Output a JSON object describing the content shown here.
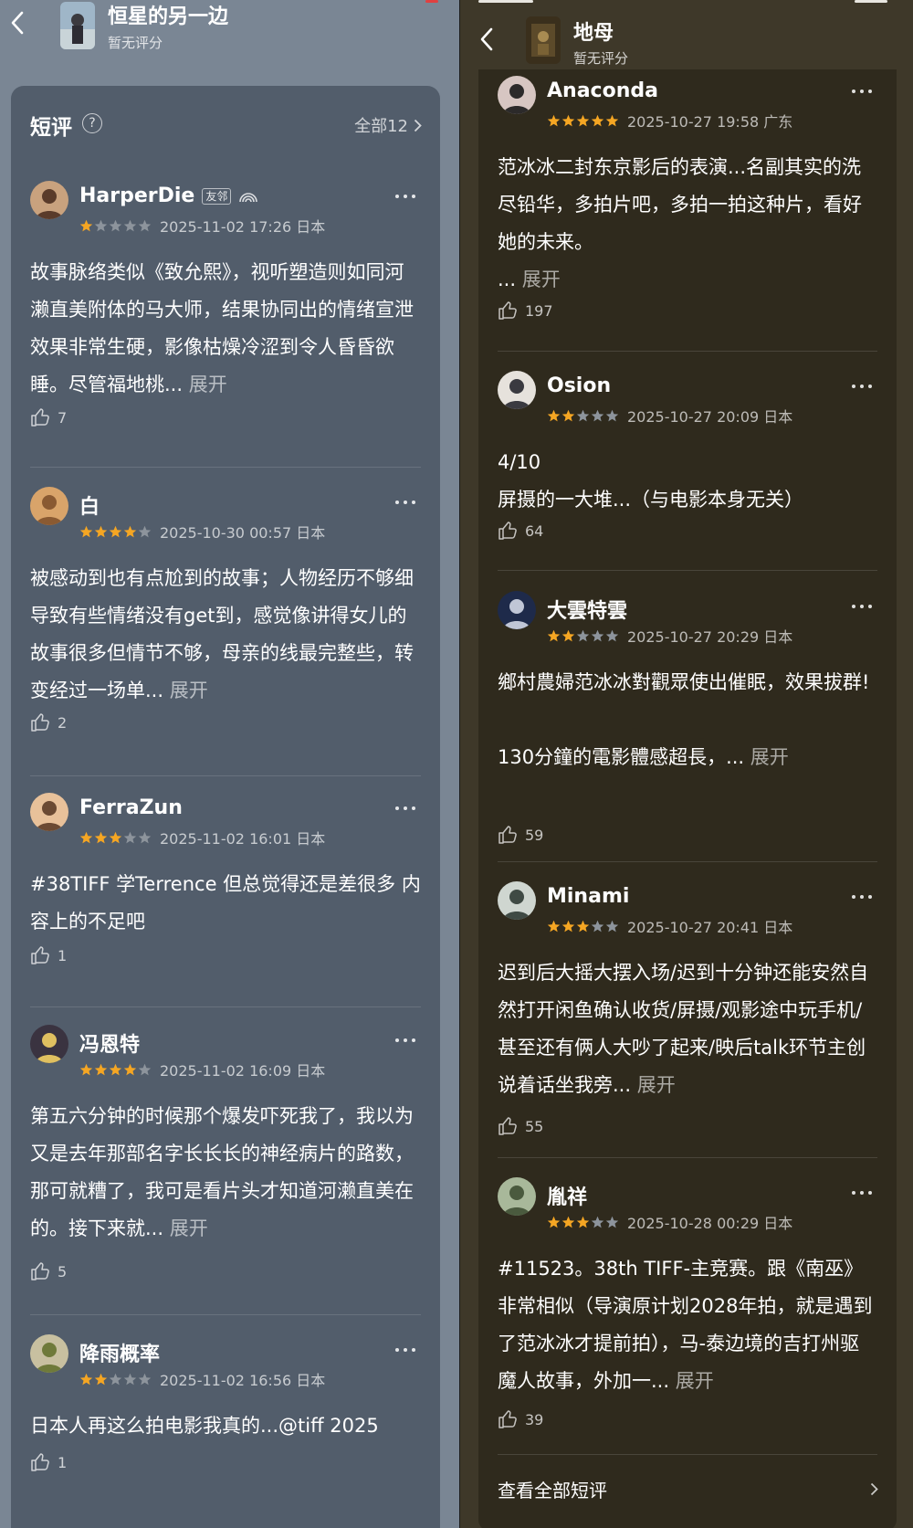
{
  "left": {
    "header": {
      "title": "恒星的另一边",
      "rating": "暂无评分"
    },
    "section": {
      "title": "短评",
      "all_link": "全部12"
    },
    "reviews": [
      {
        "user": "HarperDie",
        "badge": "友邻",
        "stars": 1,
        "meta": "2025-11-02 17:26 日本",
        "body": "故事脉络类似《致允熙》，视听塑造则如同河濑直美附体的马大师，结果协同出的情绪宣泄效果非常生硬，影像枯燥冷涩到令人昏昏欲睡。尽管福地桃...",
        "expand": "展开",
        "likes": "7"
      },
      {
        "user": "白",
        "stars": 4,
        "meta": "2025-10-30 00:57 日本",
        "body": "被感动到也有点尬到的故事；人物经历不够细导致有些情绪没有get到，感觉像讲得女儿的故事很多但情节不够，母亲的线最完整些，转变经过一场单...",
        "expand": "展开",
        "likes": "2"
      },
      {
        "user": "FerraZun",
        "stars": 3,
        "meta": "2025-11-02 16:01 日本",
        "body": "#38TIFF 学Terrence 但总觉得还是差很多 内容上的不足吧",
        "expand": "",
        "likes": "1"
      },
      {
        "user": "冯恩特",
        "stars": 4,
        "meta": "2025-11-02 16:09 日本",
        "body": "第五六分钟的时候那个爆发吓死我了，我以为又是去年那部名字长长长的神经病片的路数，那可就糟了，我可是看片头才知道河濑直美在的。接下来就...",
        "expand": "展开",
        "likes": "5"
      },
      {
        "user": "降雨概率",
        "stars": 2,
        "meta": "2025-11-02 16:56 日本",
        "body": "日本人再这么拍电影我真的...@tiff 2025",
        "expand": "",
        "likes": "1"
      }
    ]
  },
  "right": {
    "header": {
      "title": "地母",
      "rating": "暂无评分"
    },
    "reviews": [
      {
        "user": "Anaconda",
        "stars": 5,
        "meta": "2025-10-27 19:58 广东",
        "body": "范冰冰二封东京影后的表演...名副其实的洗尽铅华，多拍片吧，多拍一拍这种片，看好她的未来。",
        "prefix": "...",
        "expand": "展开",
        "likes": "197"
      },
      {
        "user": "Osion",
        "stars": 2,
        "meta": "2025-10-27 20:09 日本",
        "body": "4/10\n屏摄的一大堆...（与电影本身无关）",
        "expand": "",
        "likes": "64"
      },
      {
        "user": "大雲特雲",
        "stars": 2,
        "meta": "2025-10-27 20:29 日本",
        "body": "鄉村農婦范冰冰對觀眾使出催眠，效果拔群!\n\n130分鐘的電影體感超長，...",
        "expand": "展开",
        "likes": "59"
      },
      {
        "user": "Minami",
        "stars": 3,
        "meta": "2025-10-27 20:41 日本",
        "body": "迟到后大摇大摆入场/迟到十分钟还能安然自然打开闲鱼确认收货/屏摄/观影途中玩手机/甚至还有俩人大吵了起来/映后talk环节主创说着话坐我旁...",
        "expand": "展开",
        "likes": "55"
      },
      {
        "user": "胤祥",
        "stars": 3,
        "meta": "2025-10-28 00:29 日本",
        "body": "#11523。38th TIFF-主竞赛。跟《南巫》非常相似（导演原计划2028年拍，就是遇到了范冰冰才提前拍），马-泰边境的吉打州驱魔人故事，外加一...",
        "expand": "展开",
        "likes": "39"
      }
    ],
    "view_all": "查看全部短评"
  },
  "colors": {
    "star_on": "#f5a623",
    "star_off": "#8d949c",
    "left_bg": "#7a8694",
    "left_card": "#525d6b",
    "right_bg": "#3e3829",
    "right_card": "#2f2a1d"
  },
  "icons": [
    "back-chevron-icon",
    "help-icon",
    "chevron-right-icon",
    "more-icon",
    "thumb-up-icon",
    "star-icon",
    "rainbow-icon"
  ]
}
